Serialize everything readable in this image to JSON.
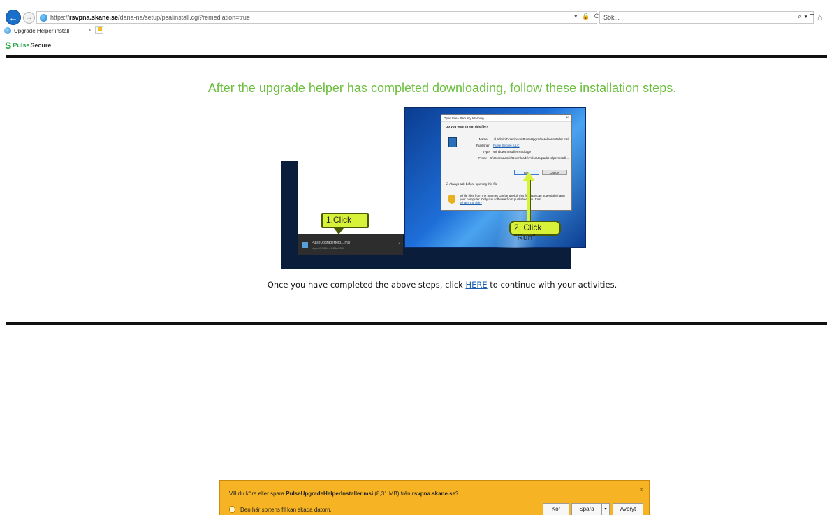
{
  "browser": {
    "url_prefix": "https://",
    "url_host": "rsvpna.skane.se",
    "url_path": "/dana-na/setup/psalinstall.cgi?remediation=true",
    "url_controls": "▾ 🔒 C",
    "search_placeholder": "Sök...",
    "search_controls": "⌕ ▾",
    "tab_title": "Upgrade Helper install",
    "tab_close": "×"
  },
  "brand": {
    "mark": "S",
    "name_part1": "Pulse",
    "name_part2": "Secure"
  },
  "content": {
    "heading": "After the upgrade helper has completed downloading, follow these installation steps.",
    "instruction_before": "Once you have completed the above steps, click ",
    "instruction_link": "HERE",
    "instruction_after": " to continue with your activities."
  },
  "illustration": {
    "callout_1": "1.Click",
    "callout_2": "2. Click \"Run\"",
    "download": {
      "file": "PulseUpgradeHelp....msi",
      "url": "https://10.204.49.24/dl/000"
    },
    "dialog": {
      "title": "Open File - Security Warning",
      "question": "Do you want to run this file?",
      "fields": [
        {
          "key": "Name:",
          "value": "...al.admin\\Downloads\\PulseUpgradeHelperInstaller.msi",
          "link": false
        },
        {
          "key": "Publisher:",
          "value": "Pulse Secure, LLC",
          "link": true
        },
        {
          "key": "Type:",
          "value": "Windows Installer Package",
          "link": false
        },
        {
          "key": "From:",
          "value": "C:\\Users\\admin\\Downloads\\PulseUpgradeHelperInstall...",
          "link": false
        }
      ],
      "run": "Run",
      "cancel": "Cancel",
      "checkbox": "Always ask before opening this file",
      "warning": "While files from the Internet can be useful, this file type can potentially harm your computer. Only run software from publishers you trust.",
      "warning_link": "What's the risk?"
    }
  },
  "notification": {
    "prompt_before": "Vill du köra eller spara ",
    "prompt_file": "PulseUpgradeHelperInstaller.msi",
    "prompt_middle": " (8,31 MB) från ",
    "prompt_host": "rsvpna.skane.se",
    "prompt_after": "?",
    "warning": "Den här sortens fil kan skada datorn.",
    "run": "Kör",
    "save": "Spara",
    "save_arrow": "▾",
    "cancel": "Avbryt",
    "close": "×",
    "color": "#f6b324"
  },
  "colors": {
    "heading": "#6abf3c",
    "link": "#1a5fb4",
    "callout": "#d8f23a"
  }
}
